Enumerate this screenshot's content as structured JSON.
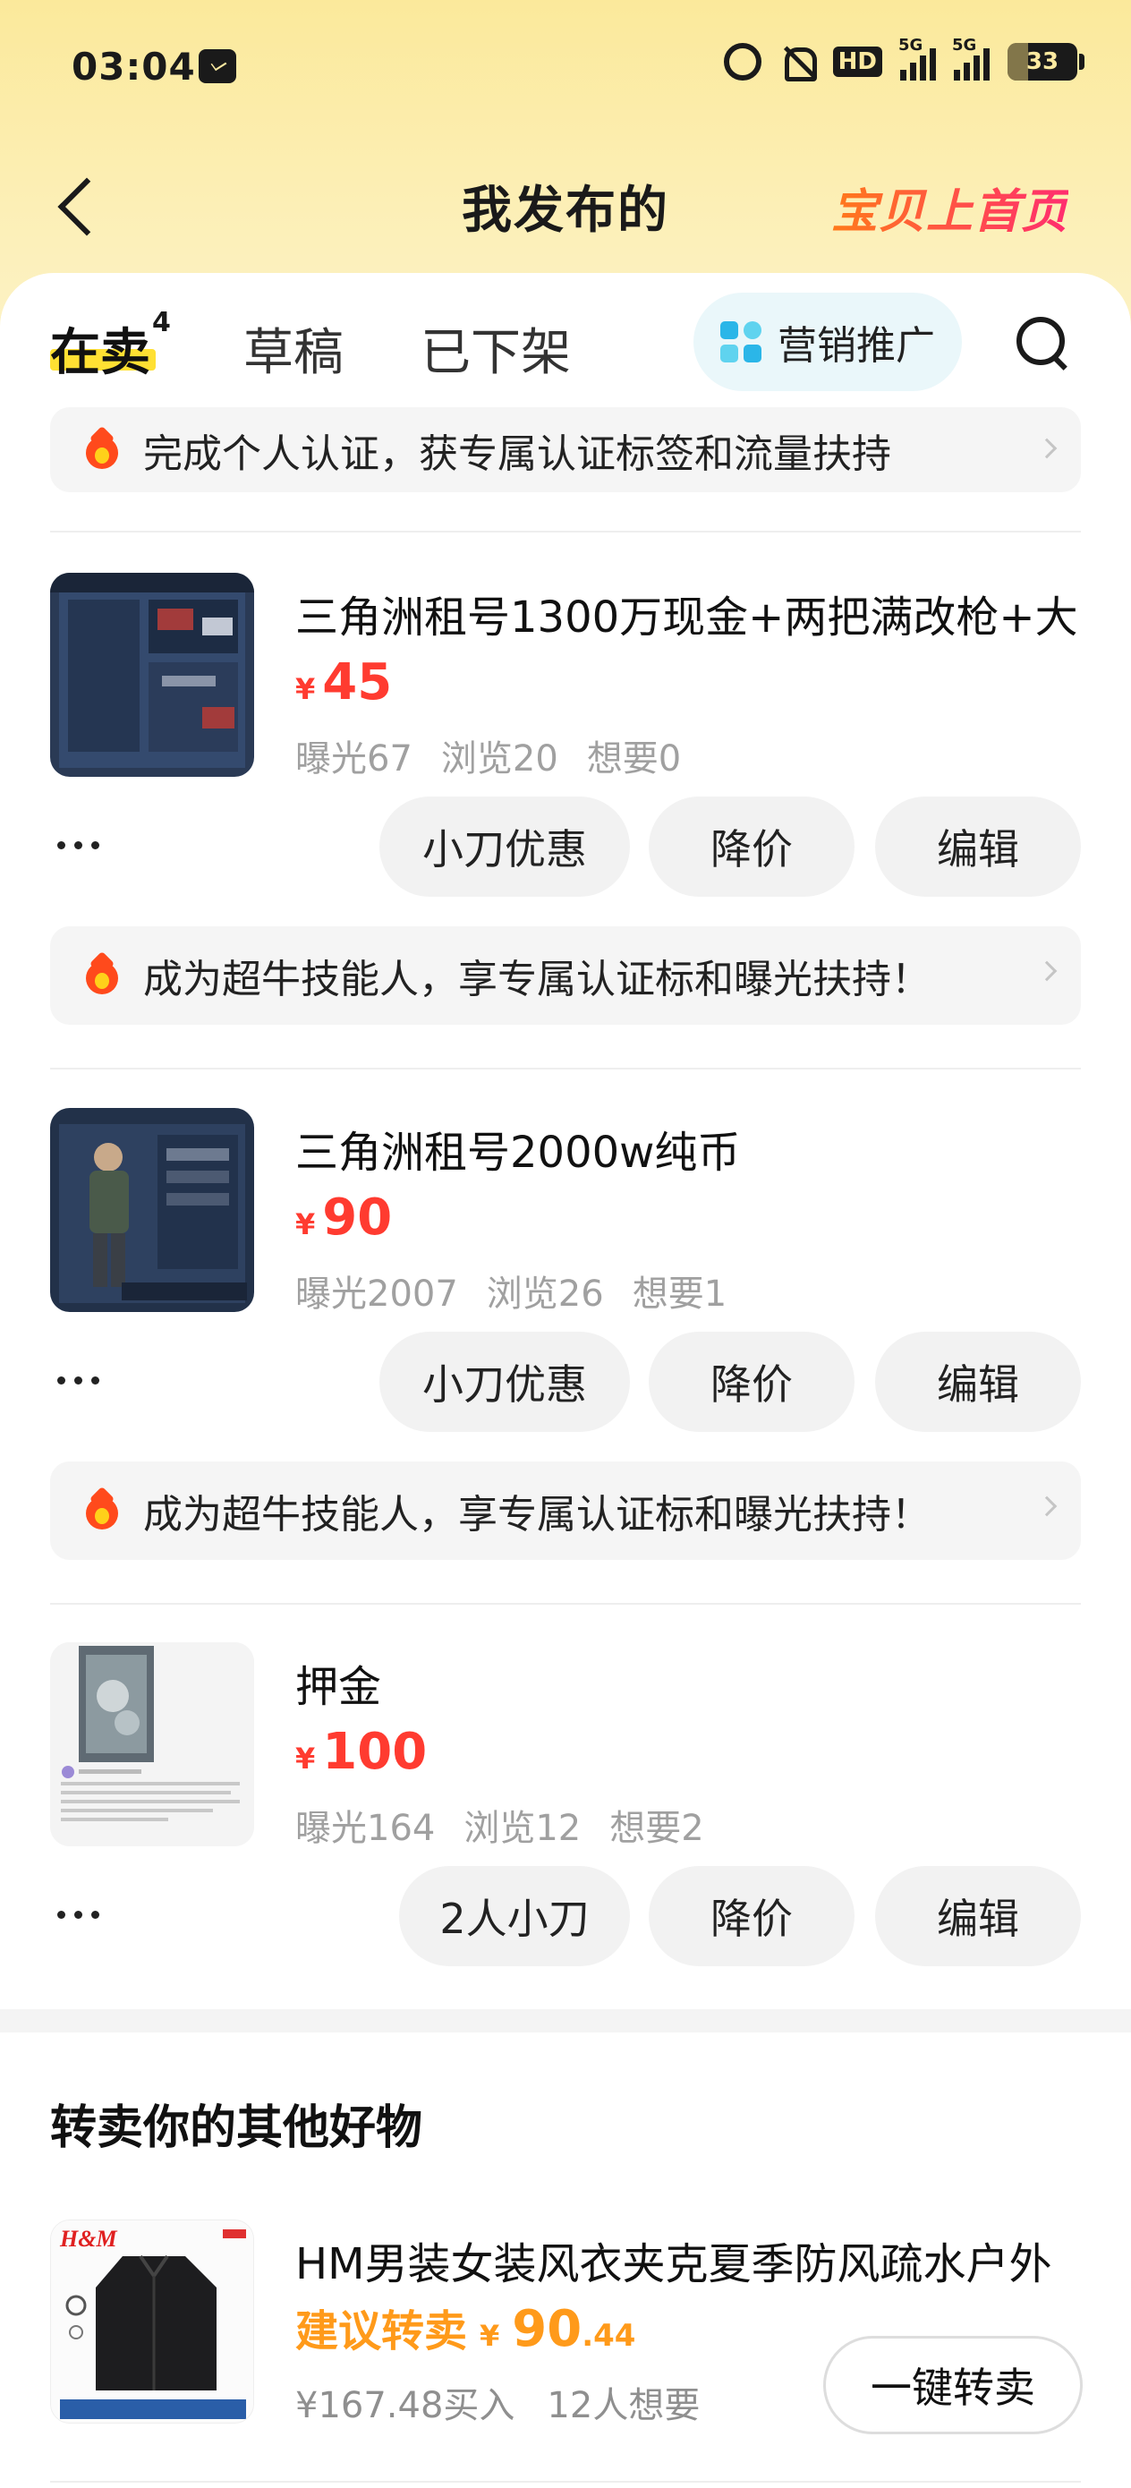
{
  "status_bar": {
    "time": "03:04",
    "battery": "33",
    "hd_label": "HD",
    "network_1": "5G",
    "network_2": "5G"
  },
  "header": {
    "title": "我发布的",
    "promo_link": "宝贝上首页"
  },
  "tabs": [
    {
      "label": "在卖",
      "badge": "4"
    },
    {
      "label": "草稿"
    },
    {
      "label": "已下架"
    }
  ],
  "marketing_button": "营销推广",
  "top_banner": "完成个人认证，获专属认证标签和流量扶持",
  "items": [
    {
      "title": "三角洲租号1300万现金+两把满改枪+大",
      "currency": "¥",
      "price": "45",
      "stats": [
        "曝光67",
        "浏览20",
        "想要0"
      ],
      "actions": [
        "小刀优惠",
        "降价",
        "编辑"
      ],
      "banner": "成为超牛技能人，享专属认证标和曝光扶持！"
    },
    {
      "title": "三角洲租号2000w纯币",
      "currency": "¥",
      "price": "90",
      "stats": [
        "曝光2007",
        "浏览26",
        "想要1"
      ],
      "actions": [
        "小刀优惠",
        "降价",
        "编辑"
      ],
      "banner": "成为超牛技能人，享专属认证标和曝光扶持！"
    },
    {
      "title": "押金",
      "currency": "¥",
      "price": "100",
      "stats": [
        "曝光164",
        "浏览12",
        "想要2"
      ],
      "actions": [
        "2人小刀",
        "降价",
        "编辑"
      ]
    }
  ],
  "resell": {
    "section_title": "转卖你的其他好物",
    "item": {
      "title": "HM男装女装风衣夹克夏季防风疏水户外",
      "suggest_label": "建议转卖",
      "currency": "¥",
      "price_int": "90",
      "price_dec": ".44",
      "bought": "¥167.48买入",
      "wanted": "12人想要",
      "button": "一键转卖",
      "thumb_brand": "H&M"
    }
  }
}
